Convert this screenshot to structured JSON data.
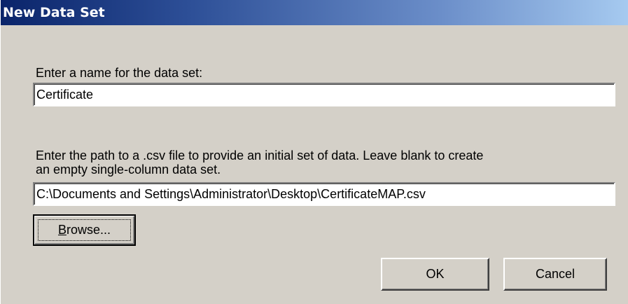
{
  "window": {
    "title": "New Data Set"
  },
  "name_field": {
    "label": "Enter a name for the data set:",
    "value": "Certificate"
  },
  "path_field": {
    "label_line1": "Enter the path to a .csv file to provide an initial set of data. Leave blank to create",
    "label_line2": "an empty single-column data set.",
    "value": "C:\\Documents and Settings\\Administrator\\Desktop\\CertificateMAP.csv"
  },
  "buttons": {
    "browse_label": "Browse...",
    "ok_label": "OK",
    "cancel_label": "Cancel"
  },
  "colors": {
    "titlebar_start": "#0a246a",
    "titlebar_end": "#a6caf0",
    "dialog_face": "#d4d0c8"
  }
}
